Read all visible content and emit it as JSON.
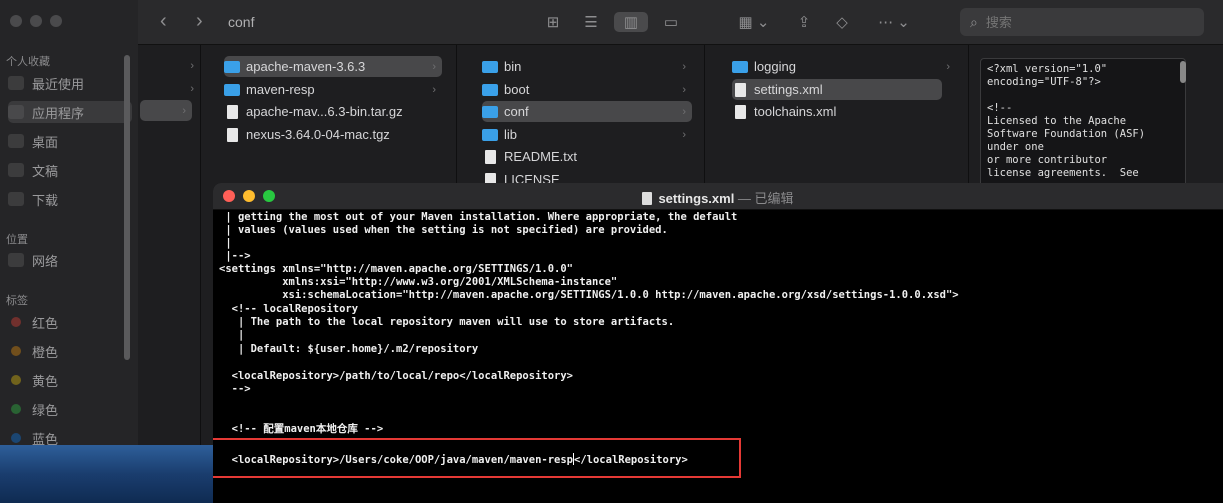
{
  "finder": {
    "sidebar": {
      "favorites_header": "个人收藏",
      "favorites": [
        {
          "label": "最近使用",
          "icon": "clock-icon"
        },
        {
          "label": "应用程序",
          "icon": "apps-icon"
        },
        {
          "label": "桌面",
          "icon": "desktop-icon"
        },
        {
          "label": "文稿",
          "icon": "document-icon"
        },
        {
          "label": "下载",
          "icon": "download-icon"
        }
      ],
      "locations_header": "位置",
      "locations": [
        {
          "label": "网络",
          "icon": "network-icon"
        }
      ],
      "tags_header": "标签",
      "tags": [
        {
          "label": "红色",
          "color": "#ff453a"
        },
        {
          "label": "橙色",
          "color": "#ff9f0a"
        },
        {
          "label": "黄色",
          "color": "#ffd60a"
        },
        {
          "label": "绿色",
          "color": "#32d74b"
        },
        {
          "label": "蓝色",
          "color": "#0a84ff"
        }
      ]
    },
    "toolbar": {
      "title": "conf",
      "search_placeholder": "搜索"
    },
    "columns": [
      [
        {
          "label": "apache-maven-3.6.3",
          "type": "folder",
          "selected": true
        },
        {
          "label": "maven-resp",
          "type": "folder"
        },
        {
          "label": "apache-mav...6.3-bin.tar.gz",
          "type": "file"
        },
        {
          "label": "nexus-3.64.0-04-mac.tgz",
          "type": "file"
        }
      ],
      [
        {
          "label": "bin",
          "type": "folder"
        },
        {
          "label": "boot",
          "type": "folder"
        },
        {
          "label": "conf",
          "type": "folder",
          "selected": true
        },
        {
          "label": "lib",
          "type": "folder"
        },
        {
          "label": "README.txt",
          "type": "file"
        },
        {
          "label": "LICENSE",
          "type": "file"
        }
      ],
      [
        {
          "label": "logging",
          "type": "folder"
        },
        {
          "label": "settings.xml",
          "type": "file",
          "selected": true
        },
        {
          "label": "toolchains.xml",
          "type": "file"
        }
      ]
    ],
    "preview_text": "<?xml version=\"1.0\"\nencoding=\"UTF-8\"?>\n\n<!--\nLicensed to the Apache\nSoftware Foundation (ASF)\nunder one\nor more contributor\nlicense agreements.  See"
  },
  "editor": {
    "filename": "settings.xml",
    "status": " — 已编辑",
    "lines": [
      " | getting the most out of your Maven installation. Where appropriate, the default",
      " | values (values used when the setting is not specified) are provided.",
      " |",
      " |-->",
      "<settings xmlns=\"http://maven.apache.org/SETTINGS/1.0.0\"",
      "          xmlns:xsi=\"http://www.w3.org/2001/XMLSchema-instance\"",
      "          xsi:schemaLocation=\"http://maven.apache.org/SETTINGS/1.0.0 http://maven.apache.org/xsd/settings-1.0.0.xsd\">",
      "  <!-- localRepository",
      "   | The path to the local repository maven will use to store artifacts.",
      "   |",
      "   | Default: ${user.home}/.m2/repository",
      "",
      "  <localRepository>/path/to/local/repo</localRepository>",
      "  -->",
      "",
      "",
      "  <!-- 配置maven本地仓库 -->",
      "",
      "  <localRepository>/Users/coke/OOP/java/maven/maven-resp",
      "</localRepository>"
    ]
  }
}
